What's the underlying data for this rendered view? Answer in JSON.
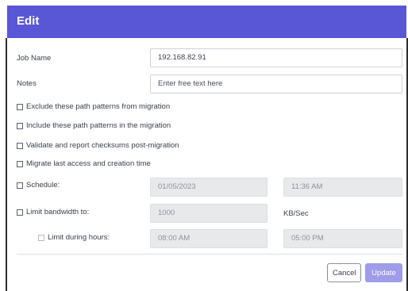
{
  "dialog": {
    "title": "Edit",
    "accent_color": "#5a57d6"
  },
  "fields": {
    "job_name": {
      "label": "Job Name",
      "value": "192.168.82.91"
    },
    "notes": {
      "label": "Notes",
      "placeholder": "Enter free text here"
    }
  },
  "options": {
    "exclude_patterns": {
      "label": "Exclude these path patterns from migration",
      "checked": false
    },
    "include_patterns": {
      "label": "Include these path patterns in the migration",
      "checked": false
    },
    "validate_checksums": {
      "label": "Validate and report checksums post-migration",
      "checked": false
    },
    "migrate_times": {
      "label": "Migrate last access and creation time",
      "checked": false
    }
  },
  "schedule": {
    "label": "Schedule:",
    "checked": false,
    "date": "01/05/2023",
    "time": "11:36 AM"
  },
  "bandwidth": {
    "label": "Limit bandwidth to:",
    "checked": false,
    "value": "1000",
    "unit": "KB/Sec",
    "hours": {
      "label": "Limit during hours:",
      "checked": false,
      "start": "08:00 AM",
      "end": "05:00 PM"
    }
  },
  "actions": {
    "cancel_label": "Cancel",
    "update_label": "Update"
  }
}
